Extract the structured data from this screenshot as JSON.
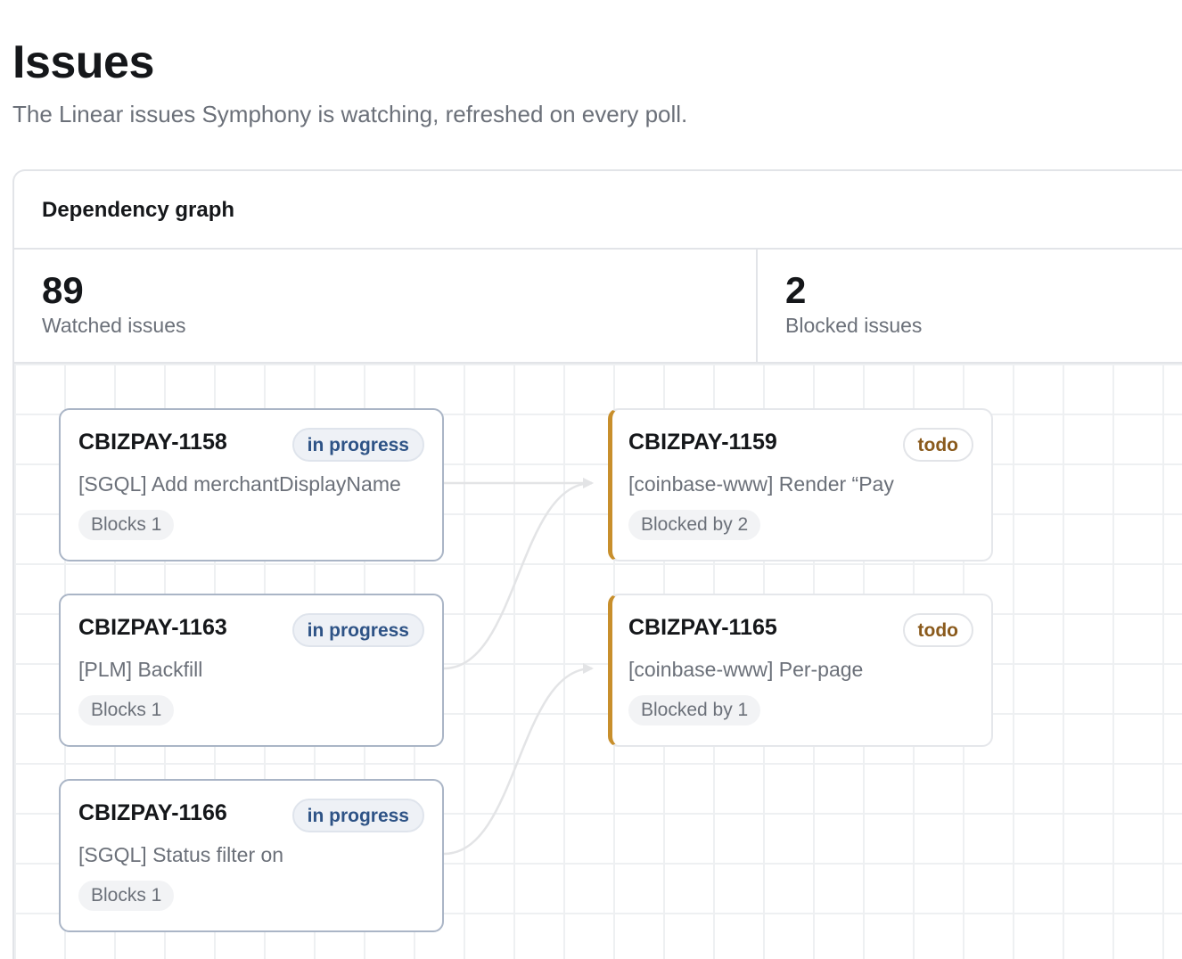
{
  "header": {
    "title": "Issues",
    "subtitle": "The Linear issues Symphony is watching, refreshed on every poll."
  },
  "panel": {
    "title": "Dependency graph",
    "stats": [
      {
        "value": "89",
        "label": "Watched issues"
      },
      {
        "value": "2",
        "label": "Blocked issues"
      }
    ]
  },
  "graph": {
    "sources": [
      {
        "id": "CBIZPAY-1158",
        "status": "in progress",
        "title": "[SGQL] Add merchantDisplayName",
        "tag": "Blocks 1"
      },
      {
        "id": "CBIZPAY-1163",
        "status": "in progress",
        "title": "[PLM] Backfill",
        "tag": "Blocks 1"
      },
      {
        "id": "CBIZPAY-1166",
        "status": "in progress",
        "title": "[SGQL] Status filter on",
        "tag": "Blocks 1"
      }
    ],
    "targets": [
      {
        "id": "CBIZPAY-1159",
        "status": "todo",
        "title": "[coinbase-www] Render “Pay",
        "tag": "Blocked by 2"
      },
      {
        "id": "CBIZPAY-1165",
        "status": "todo",
        "title": "[coinbase-www] Per-page",
        "tag": "Blocked by 1"
      }
    ],
    "edges": [
      {
        "from": "CBIZPAY-1158",
        "to": "CBIZPAY-1159"
      },
      {
        "from": "CBIZPAY-1163",
        "to": "CBIZPAY-1159"
      },
      {
        "from": "CBIZPAY-1166",
        "to": "CBIZPAY-1165"
      }
    ],
    "colors": {
      "blocked_accent": "#c88f2c",
      "edge": "#e3e4e6",
      "in_progress_text": "#2e5386",
      "todo_text": "#8a5a1c"
    }
  }
}
